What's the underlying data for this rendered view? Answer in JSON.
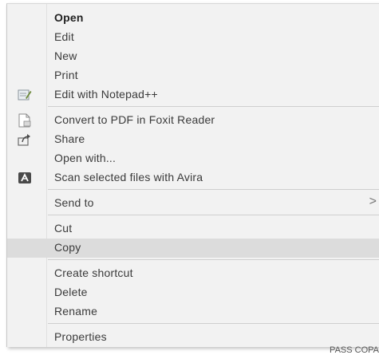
{
  "menu": {
    "items": [
      {
        "label": "Open"
      },
      {
        "label": "Edit"
      },
      {
        "label": "New"
      },
      {
        "label": "Print"
      },
      {
        "label": "Edit with Notepad++",
        "icon": "notepad-plus-plus-icon"
      },
      {
        "label": "Convert to PDF in Foxit Reader",
        "icon": "foxit-pdf-icon"
      },
      {
        "label": "Share",
        "icon": "share-icon"
      },
      {
        "label": "Open with..."
      },
      {
        "label": "Scan selected files with Avira",
        "icon": "avira-icon"
      },
      {
        "label": "Send to",
        "submenu_arrow": ">"
      },
      {
        "label": "Cut"
      },
      {
        "label": "Copy",
        "highlighted": true
      },
      {
        "label": "Create shortcut"
      },
      {
        "label": "Delete"
      },
      {
        "label": "Rename"
      },
      {
        "label": "Properties"
      }
    ]
  },
  "background_text": "PASS COPA"
}
